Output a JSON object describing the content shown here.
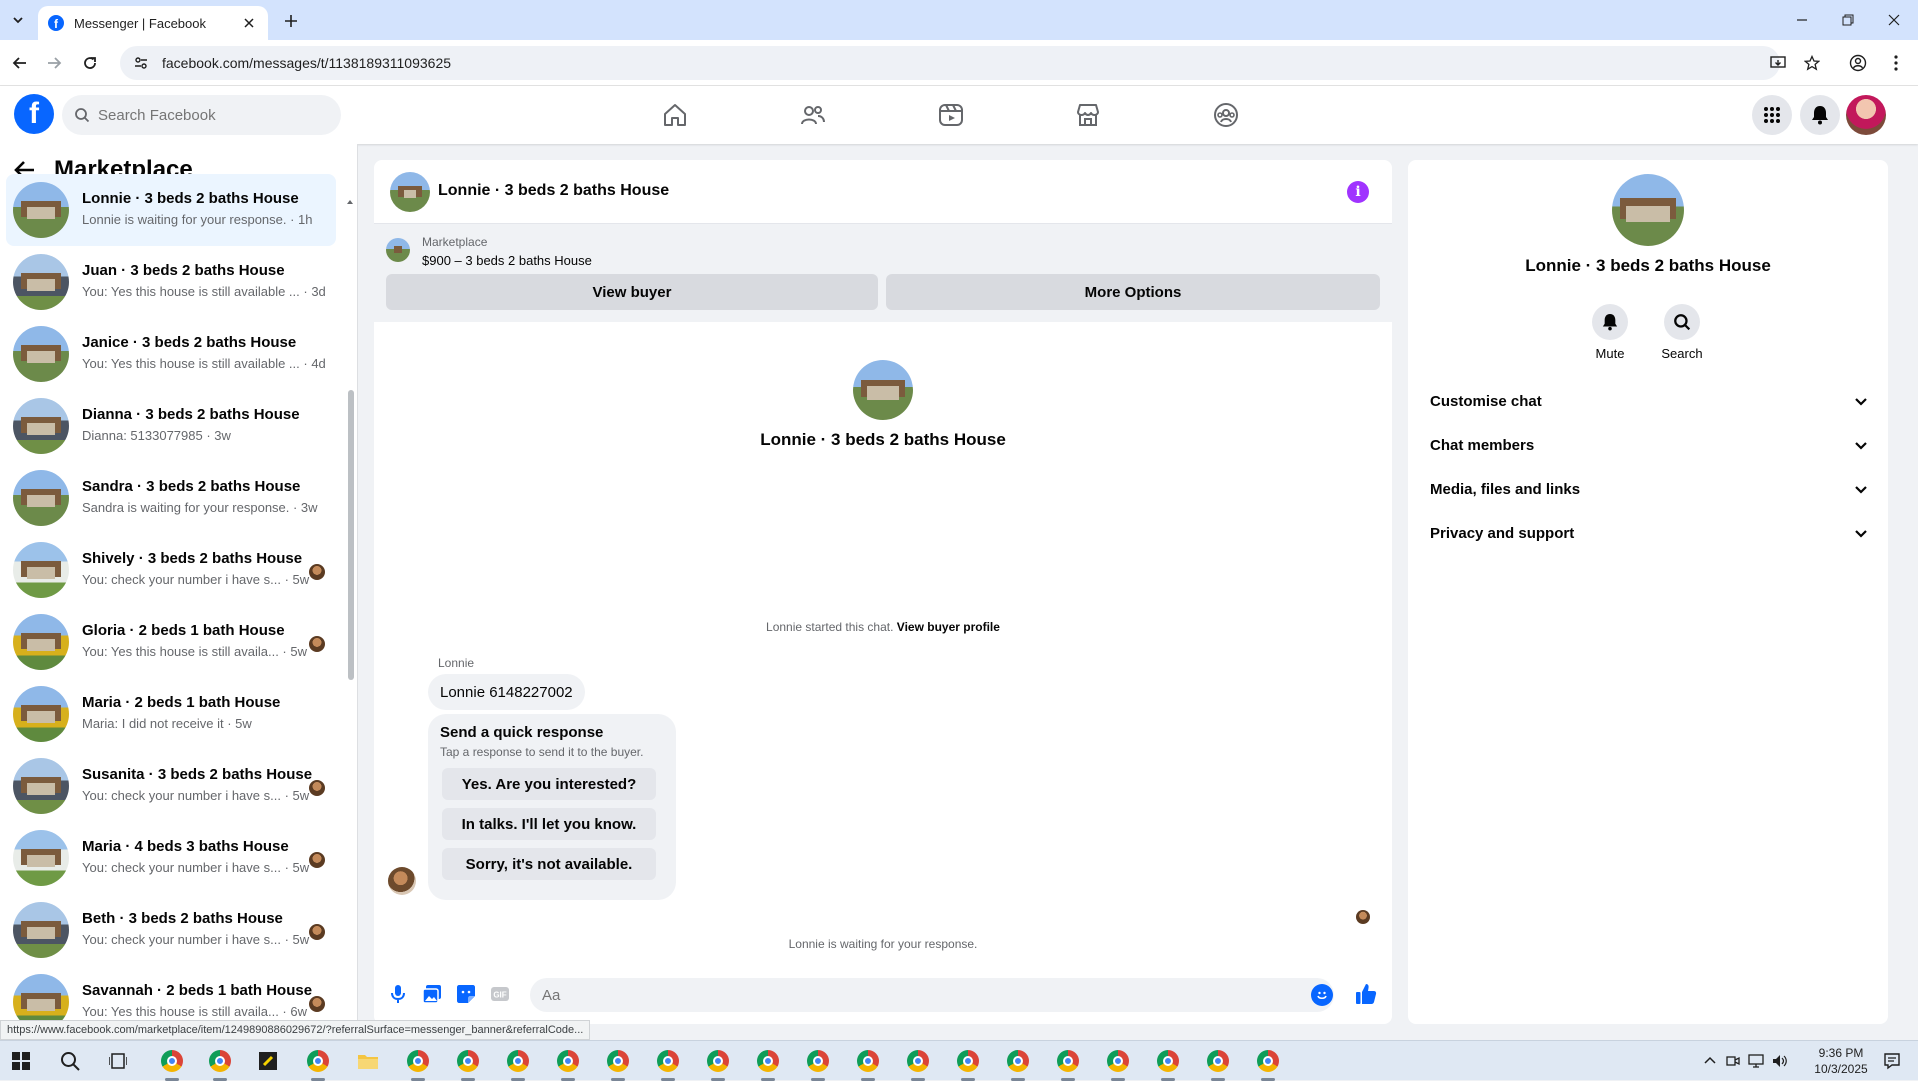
{
  "browser": {
    "tab_title": "Messenger | Facebook",
    "url": "facebook.com/messages/t/1138189311093625",
    "status_url": "https://www.facebook.com/marketplace/item/1249890886029672/?referralSurface=messenger_banner&referralCode..."
  },
  "header": {
    "logo": "f",
    "search_placeholder": "Search Facebook"
  },
  "left_panel": {
    "title": "Marketplace",
    "chats": [
      {
        "name": "Lonnie · 3 beds 2 baths House",
        "preview": "Lonnie is waiting for your response. · 1h",
        "thumb": "house1",
        "active": true
      },
      {
        "name": "Juan · 3 beds 2 baths House",
        "preview": "You: Yes this house is still available ... · 3d",
        "thumb": "house2"
      },
      {
        "name": "Janice · 3 beds 2 baths House",
        "preview": "You: Yes this house is still available ... · 4d",
        "thumb": "house1"
      },
      {
        "name": "Dianna · 3 beds 2 baths House",
        "preview": "Dianna: 5133077985 · 3w",
        "thumb": "house2"
      },
      {
        "name": "Sandra · 3 beds 2 baths House",
        "preview": "Sandra is waiting for your response. · 3w",
        "thumb": "house1"
      },
      {
        "name": "Shively · 3 beds 2 baths House",
        "preview": "You: check your number i have s... · 5w",
        "thumb": "house3",
        "mini": true
      },
      {
        "name": "Gloria · 2 beds 1 bath House",
        "preview": "You: Yes this house is still availa... · 5w",
        "thumb": "house4",
        "mini": true
      },
      {
        "name": "Maria · 2 beds 1 bath House",
        "preview": "Maria: I did not receive it · 5w",
        "thumb": "house4"
      },
      {
        "name": "Susanita · 3 beds 2 baths House",
        "preview": "You: check your number i have s... · 5w",
        "thumb": "house2",
        "mini": true
      },
      {
        "name": "Maria · 4 beds 3 baths House",
        "preview": "You: check your number i have s... · 5w",
        "thumb": "house3",
        "mini": true
      },
      {
        "name": "Beth · 3 beds 2 baths House",
        "preview": "You: check your number i have s... · 5w",
        "thumb": "house2",
        "mini": true
      },
      {
        "name": "Savannah · 2 beds 1 bath House",
        "preview": "You: Yes this house is still availa... · 6w",
        "thumb": "house4",
        "mini": true
      }
    ]
  },
  "chat": {
    "title": "Lonnie · 3 beds 2 baths House",
    "marketplace_label": "Marketplace",
    "listing": "$900 – 3 beds 2 baths House",
    "view_buyer": "View buyer",
    "more_options": "More Options",
    "center_name": "Lonnie · 3 beds 2 baths House",
    "started_text": "Lonnie started this chat.",
    "view_profile": "View buyer profile",
    "sender": "Lonnie",
    "message": "Lonnie 6148227002",
    "quick_title": "Send a quick response",
    "quick_sub": "Tap a response to send it to the buyer.",
    "quick_responses": [
      "Yes. Are you interested?",
      "In talks. I'll let you know.",
      "Sorry, it's not available."
    ],
    "waiting": "Lonnie is waiting for your response.",
    "composer_placeholder": "Aa"
  },
  "right_panel": {
    "name": "Lonnie · 3 beds 2 baths House",
    "mute": "Mute",
    "search": "Search",
    "sections": [
      "Customise chat",
      "Chat members",
      "Media, files and links",
      "Privacy and support"
    ]
  },
  "taskbar": {
    "time": "9:36 PM",
    "date": "10/3/2025"
  },
  "colors": {
    "fb_blue": "#0866ff",
    "info_purple": "#a033ff",
    "active_chat": "#ebf5ff"
  }
}
